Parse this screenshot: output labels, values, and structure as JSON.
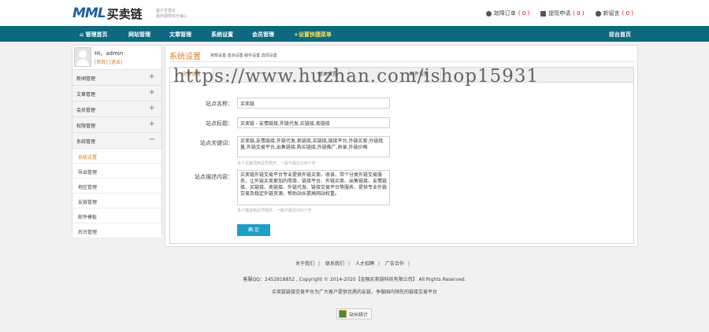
{
  "header": {
    "logo_text": "MML",
    "logo_cn": "买卖链",
    "slogan": "客户至尊化\n最终期限欢乐每心",
    "links": [
      {
        "label": "故障订单",
        "count": "( 0 )"
      },
      {
        "label": "提现申请",
        "count": "( 0 )"
      },
      {
        "label": "新留言",
        "count": "( 0 )"
      }
    ]
  },
  "nav": {
    "items": [
      "管理首页",
      "网站管理",
      "文章管理",
      "系统设置",
      "会员管理",
      "+设置快捷菜单"
    ],
    "right": "前台首页"
  },
  "sidebar": {
    "username": "Hi，admin",
    "user_links": "[修改] [退出]",
    "groups": [
      "新闻管理",
      "文章管理",
      "会员管理",
      "权限管理",
      "系统管理"
    ],
    "sub_items": [
      "系统设置",
      "导出管理",
      "地区管理",
      "友链管理",
      "邮件模板",
      "后台管理"
    ]
  },
  "main": {
    "title": "系统设置",
    "crumb": "常规设置  基本设置  邮件设置  选项设置",
    "tabs": [
      "常规设置",
      "基本设置",
      "邮件设置"
    ],
    "fields": {
      "site_name_label": "站点名称：",
      "site_name_value": "买卖链",
      "site_title_label": "站点标题：",
      "site_title_value": "买卖链 - 友情链接,外链代发,买链接,卖链接",
      "keywords_label": "站点关键词：",
      "keywords_value": "买卖链,友情链接,外链代发,卖链接,买链接,链接平台,外链买卖,外链批量,外链交易平台,出售链接,购买链接,外链推广,收录,外链价格",
      "keywords_hint": "多个关键词用逗号隔开，一般不超过100个字",
      "desc_label": "站点描述内容：",
      "desc_value": "买卖链外链交易平台专业提供外链买卖、收录、带个分类外链交易服务，让外链买卖更加的简单、链接平台、外链买卖、出售链接、友情链接、买链接、卖链接、外链代发、链接交易平台等服务，提供专业外链交易及稳定外链资源，帮助站长提高网站权重。",
      "desc_hint": "多个描述用逗号隔开，一般不超过200个字",
      "submit_label": "确 定"
    }
  },
  "watermark": "https://www.huzhan.com/ishop15931",
  "footer": {
    "links": [
      "关于我们",
      "联系我们",
      "人才招聘",
      "广告合作"
    ],
    "copyright": "客服QQ：2452818852 , Copyright © 2014-2020【金融买卖链科技有限公司】 All Rights Reserved.",
    "tagline": "买卖链链接交易平台为广大客户提供优质的友链，争做国内领先的链接交易平台",
    "badge": "站长统计"
  }
}
